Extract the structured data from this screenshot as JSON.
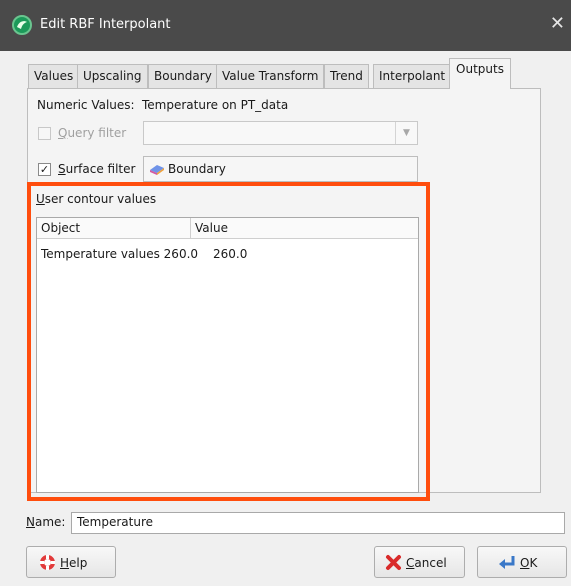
{
  "window": {
    "title": "Edit RBF Interpolant",
    "close_glyph": "✕"
  },
  "tabs": [
    {
      "label": "Values"
    },
    {
      "label": "Upscaling"
    },
    {
      "label": "Boundary"
    },
    {
      "label": "Value Transform"
    },
    {
      "label": "Trend"
    },
    {
      "label": "Interpolant"
    },
    {
      "label": "Outputs",
      "active": true
    }
  ],
  "numeric_values": {
    "label": "Numeric Values:",
    "value": "Temperature on PT_data"
  },
  "query_filter": {
    "label_prefix": "Q",
    "label_rest": "uery filter",
    "checked": false,
    "enabled": false,
    "value": ""
  },
  "surface_filter": {
    "label_prefix": "S",
    "label_rest": "urface filter",
    "checked": true,
    "check_glyph": "✓",
    "value": "Boundary"
  },
  "contours": {
    "label_prefix": "U",
    "label_rest": "ser contour values",
    "columns": [
      "Object",
      "Value"
    ],
    "rows": [
      {
        "object": "Temperature values 260.0",
        "value": "260.0"
      }
    ]
  },
  "name": {
    "label_prefix": "N",
    "label_rest": "ame:",
    "value": "Temperature"
  },
  "buttons": {
    "help": {
      "prefix": "H",
      "rest": "elp"
    },
    "cancel": {
      "prefix": "C",
      "rest": "ancel"
    },
    "ok": {
      "prefix": "O",
      "rest": "K"
    }
  },
  "colors": {
    "highlight": "#ff4d0d",
    "titlebar": "#4a4a4a"
  }
}
